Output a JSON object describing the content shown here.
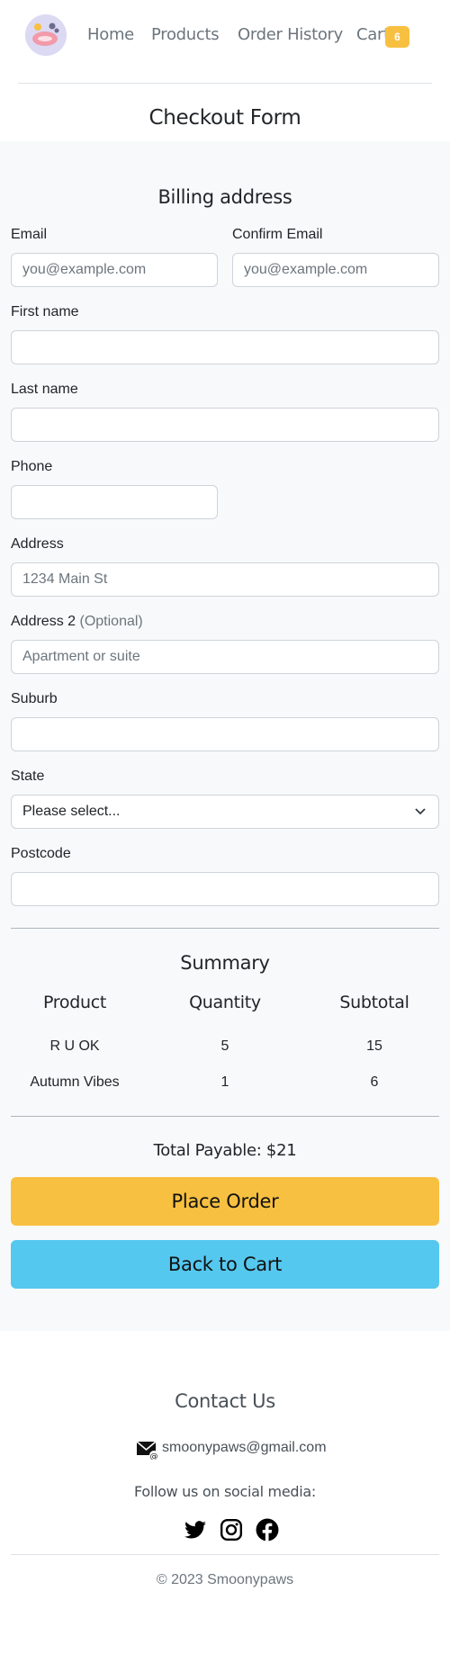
{
  "nav": {
    "links": [
      {
        "label": "Home"
      },
      {
        "label": "Products"
      },
      {
        "label": "Order History"
      },
      {
        "label": "Cart"
      }
    ],
    "cart_count": "6"
  },
  "page_title": "Checkout Form",
  "billing": {
    "title": "Billing address",
    "email_label": "Email",
    "email_placeholder": "you@example.com",
    "confirm_email_label": "Confirm Email",
    "confirm_email_placeholder": "you@example.com",
    "first_name_label": "First name",
    "last_name_label": "Last name",
    "phone_label": "Phone",
    "address_label": "Address",
    "address_placeholder": "1234 Main St",
    "address2_label": "Address 2",
    "address2_optional": "(Optional)",
    "address2_placeholder": "Apartment or suite",
    "suburb_label": "Suburb",
    "state_label": "State",
    "state_value": "Please select...",
    "postcode_label": "Postcode"
  },
  "summary": {
    "title": "Summary",
    "headers": [
      "Product",
      "Quantity",
      "Subtotal"
    ],
    "rows": [
      {
        "product": "R U OK",
        "quantity": "5",
        "subtotal": "15"
      },
      {
        "product": "Autumn Vibes",
        "quantity": "1",
        "subtotal": "6"
      }
    ],
    "total": "Total Payable: $21",
    "place_order": "Place Order",
    "back_to_cart": "Back to Cart"
  },
  "footer": {
    "contact_title": "Contact Us",
    "email": "smoonypaws@gmail.com",
    "follow_text": "Follow us on social media:",
    "social_icons": [
      "twitter-icon",
      "instagram-icon",
      "facebook-icon"
    ],
    "copyright": "© 2023 Smoonypaws"
  },
  "colors": {
    "accent_yellow": "#f8c041",
    "accent_blue": "#55c8ef",
    "section_bg": "#f8f9fa"
  }
}
